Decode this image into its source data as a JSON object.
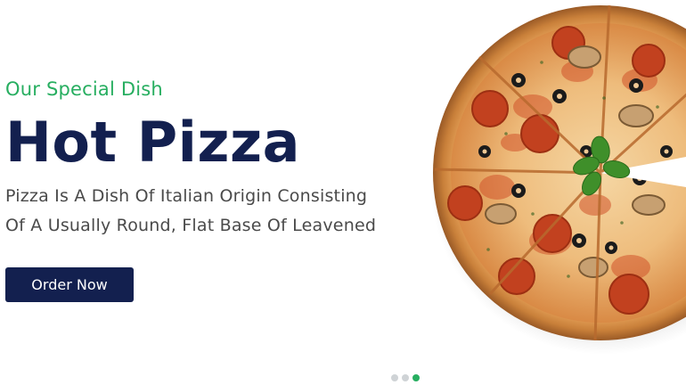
{
  "hero": {
    "subtitle": "Our Special Dish",
    "title": "Hot Pizza",
    "description_lines": [
      "Pizza Is A Dish Of Italian Origin Consisting",
      "Of A Usually Round, Flat Base Of Leavened"
    ],
    "cta_label": "Order Now"
  },
  "carousel": {
    "slide_count": 3,
    "active_index": 2
  },
  "colors": {
    "accent_green": "#27ae60",
    "title_navy": "#13204f",
    "button_bg": "#13204f",
    "dot_inactive": "#cfd3d6"
  },
  "image": {
    "subject": "pizza-icon"
  }
}
